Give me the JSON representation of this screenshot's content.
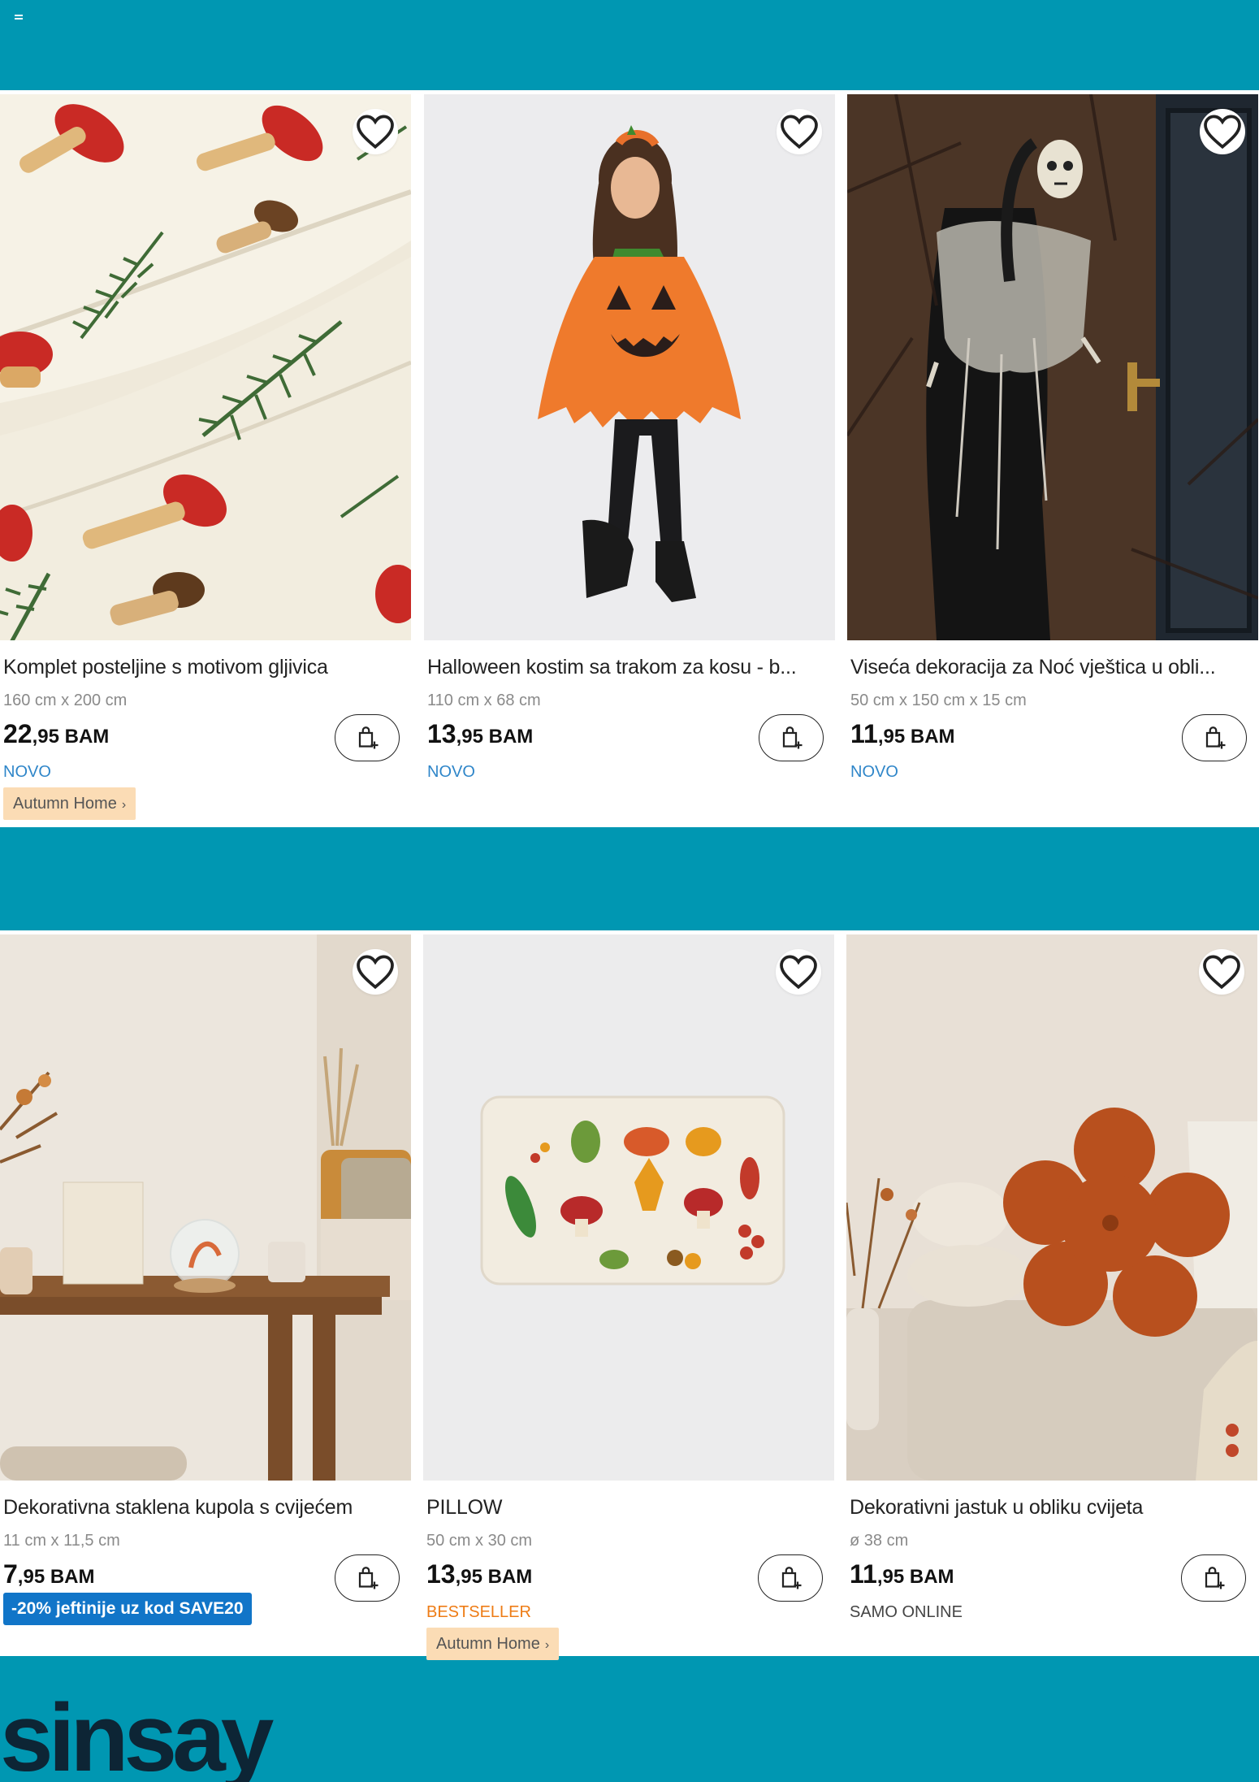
{
  "header": {
    "menu_icon": "hamburger-icon"
  },
  "section1": {
    "products": [
      {
        "title": "Komplet posteljine s motivom gljivica",
        "size": "160 cm x 200 cm",
        "price_main": "22",
        "price_rest": ",95 BAM",
        "tag": "NOVO",
        "chip": "Autumn Home"
      },
      {
        "title": "Halloween kostim sa trakom za kosu - b...",
        "size": "110 cm x 68 cm",
        "price_main": "13",
        "price_rest": ",95 BAM",
        "tag": "NOVO"
      },
      {
        "title": "Viseća dekoracija za Noć vještica u obli...",
        "size": "50 cm x 150 cm x 15 cm",
        "price_main": "11",
        "price_rest": ",95 BAM",
        "tag": "NOVO"
      }
    ]
  },
  "section2": {
    "products": [
      {
        "title": "Dekorativna staklena kupola s cvijećem",
        "size": "11 cm x 11,5 cm",
        "price_main": "7",
        "price_rest": ",95 BAM",
        "promo": "-20% jeftinije uz kod SAVE20"
      },
      {
        "title": "PILLOW",
        "size": "50 cm x 30 cm",
        "price_main": "13",
        "price_rest": ",95 BAM",
        "tag": "BESTSELLER",
        "chip": "Autumn Home"
      },
      {
        "title": "Dekorativni jastuk u obliku cvijeta",
        "size": "ø 38 cm",
        "price_main": "11",
        "price_rest": ",95 BAM",
        "tag": "SAMO ONLINE"
      }
    ]
  },
  "icons": {
    "favorite": "heart-icon",
    "cart": "add-to-cart-icon",
    "chevron": "chevron-right-icon"
  },
  "colors": {
    "brand": "#0097b2",
    "novo": "#2f86c9",
    "bestseller": "#ee7c16",
    "chip": "#fbdcb5",
    "promo": "#1175c8"
  },
  "footer": {
    "logo_text": "sinsay"
  }
}
